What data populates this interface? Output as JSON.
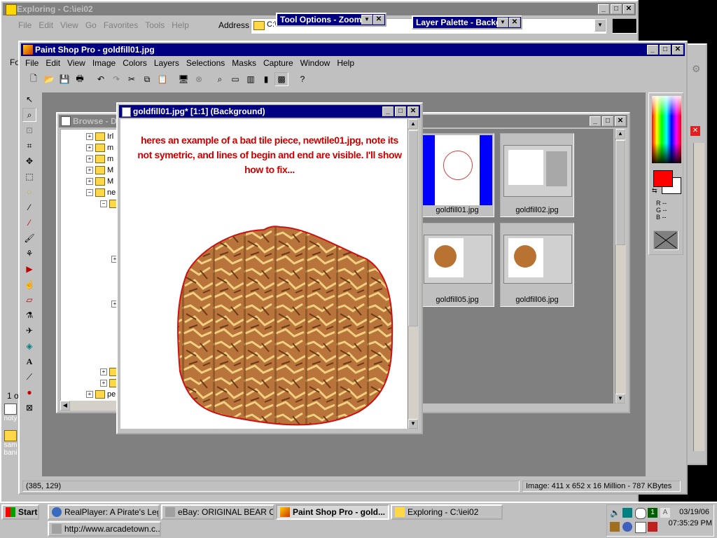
{
  "explorer": {
    "title": "Exploring - C:\\iei02",
    "menu": [
      "File",
      "Edit",
      "View",
      "Go",
      "Favorites",
      "Tools",
      "Help"
    ],
    "address_label": "Address",
    "address_value": "C:\\iei02",
    "status_fragment": "1 o",
    "side_label": "Fo"
  },
  "tool_options": {
    "title": "Tool Options - Zoom"
  },
  "layer_palette": {
    "title": "Layer Palette - Backg"
  },
  "psp": {
    "title": "Paint Shop Pro - goldfill01.jpg",
    "menu": [
      "File",
      "Edit",
      "View",
      "Image",
      "Colors",
      "Layers",
      "Selections",
      "Masks",
      "Capture",
      "Window",
      "Help"
    ],
    "status_coords": "(385, 129)",
    "status_image": "Image:  411 x 652 x 16 Million - 787 KBytes",
    "color_readout": {
      "r": "R --",
      "g": "G --",
      "b": "B --"
    },
    "fg_color": "#ff0000",
    "bg_color": "#ffffff"
  },
  "browse": {
    "title": "Browse - D",
    "tree": [
      "Irl",
      "m",
      "m",
      "M",
      "M",
      "ne",
      "",
      "",
      "",
      "",
      "",
      "pe"
    ],
    "thumbs": [
      {
        "label": "goldfill01.jpg",
        "selected": true
      },
      {
        "label": "goldfill02.jpg",
        "selected": false
      },
      {
        "label": "goldfill05.jpg",
        "selected": false
      },
      {
        "label": "goldfill06.jpg",
        "selected": false
      }
    ]
  },
  "image_window": {
    "title": "goldfill01.jpg* [1:1] (Background)",
    "annotation": "heres an example of a bad tile piece, newtile01.jpg, note its not symetric, and lines of begin and end are visible.  I'll show how to fix..."
  },
  "desktop": {
    "icons": [
      {
        "label": "noty"
      },
      {
        "label": "sam bani"
      }
    ]
  },
  "taskbar": {
    "start": "Start",
    "buttons": [
      {
        "label": "RealPlayer: A Pirate's Leg...",
        "active": false
      },
      {
        "label": "eBay: ORIGINAL BEAR C...",
        "active": false
      },
      {
        "label": "Paint Shop Pro - gold...",
        "active": true
      },
      {
        "label": "Exploring - C:\\iei02",
        "active": false
      },
      {
        "label": "http://www.arcadetown.c...",
        "active": false
      }
    ],
    "date": "03/19/06",
    "time": "07:35:29 PM"
  }
}
